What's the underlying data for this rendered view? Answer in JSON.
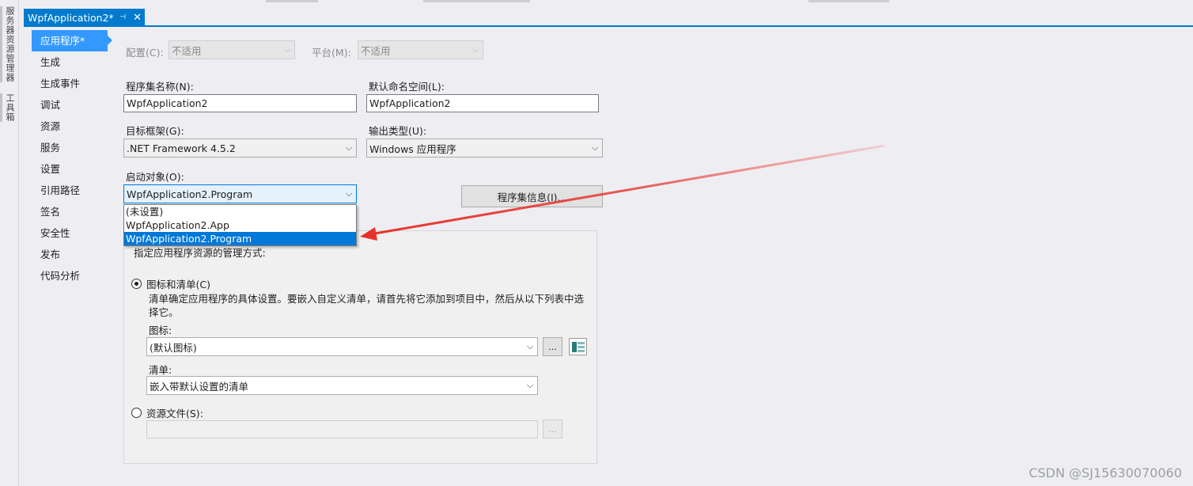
{
  "side_tabs": [
    "服务器资源管理器",
    "工具箱"
  ],
  "doc_tab": {
    "title": "WpfApplication2*",
    "pin": "⊣",
    "close": "✕"
  },
  "nav": {
    "items": [
      "应用程序*",
      "生成",
      "生成事件",
      "调试",
      "资源",
      "服务",
      "设置",
      "引用路径",
      "签名",
      "安全性",
      "发布",
      "代码分析"
    ]
  },
  "config": {
    "label": "配置(C):",
    "value": "不适用"
  },
  "platform": {
    "label": "平台(M):",
    "value": "不适用"
  },
  "assembly_name": {
    "label": "程序集名称(N):",
    "value": "WpfApplication2"
  },
  "default_namespace": {
    "label": "默认命名空间(L):",
    "value": "WpfApplication2"
  },
  "target_framework": {
    "label": "目标框架(G):",
    "value": ".NET Framework 4.5.2"
  },
  "output_type": {
    "label": "输出类型(U):",
    "value": "Windows 应用程序"
  },
  "startup_object": {
    "label": "启动对象(O):",
    "value": "WpfApplication2.Program",
    "options": [
      "(未设置)",
      "WpfApplication2.App",
      "WpfApplication2.Program"
    ],
    "selected_index": 2
  },
  "assembly_info_button": "程序集信息(I)...",
  "resources": {
    "caption": "指定应用程序资源的管理方式:",
    "icon_manifest_radio": "图标和清单(C)",
    "description": "清单确定应用程序的具体设置。要嵌入自定义清单，请首先将它添加到项目中，然后从以下列表中选择它。",
    "icon_label": "图标:",
    "icon_value": "(默认图标)",
    "browse": "...",
    "manifest_label": "清单:",
    "manifest_value": "嵌入带默认设置的清单",
    "resource_file_radio": "资源文件(S):",
    "resource_file_value": ""
  },
  "watermark": "CSDN @SJ15630070060",
  "colors": {
    "accent": "#007acc",
    "selection": "#0078d7",
    "nav_active": "#3399ff",
    "annotation_arrow": "#e8312a"
  }
}
